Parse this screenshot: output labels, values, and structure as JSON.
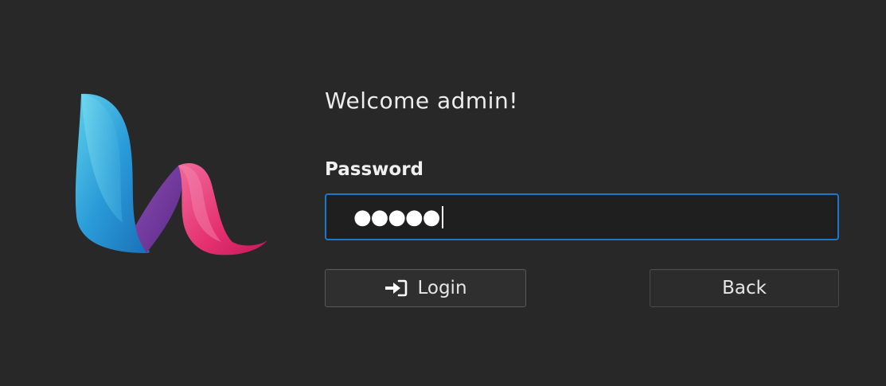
{
  "logo": {
    "icon": "brand-logo"
  },
  "welcome": {
    "text": "Welcome admin!"
  },
  "password": {
    "label": "Password",
    "masked_value": "●●●●●",
    "focused": true
  },
  "buttons": {
    "login_label": "Login",
    "login_icon": "login-arrow-icon",
    "back_label": "Back"
  },
  "colors": {
    "background": "#282828",
    "focus_border": "#1c78c8",
    "logo_blue": "#2a9bd8",
    "logo_purple": "#7a3fa0",
    "logo_pink": "#e4407a"
  }
}
